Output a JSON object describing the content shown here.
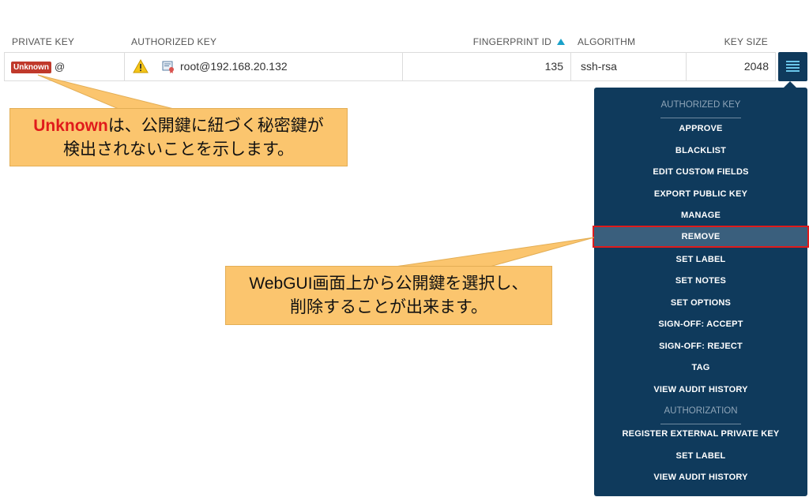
{
  "table": {
    "headers": {
      "private_key": "PRIVATE KEY",
      "authorized_key": "AUTHORIZED KEY",
      "fingerprint_id": "FINGERPRINT ID",
      "algorithm": "ALGORITHM",
      "key_size": "KEY SIZE"
    },
    "sort_icon": "sort-ascending-icon",
    "row": {
      "private_key_badge": "Unknown",
      "private_key_suffix": "@",
      "warning_icon": "warning-icon",
      "cert_icon": "certificate-icon",
      "authorized_key": "root@192.168.20.132",
      "fingerprint_id": "135",
      "algorithm": "ssh-rsa",
      "key_size": "2048"
    },
    "menu_icon": "hamburger-menu-icon"
  },
  "dropdown": {
    "section_authorized_key": "AUTHORIZED KEY",
    "authorized_key_items": [
      "APPROVE",
      "BLACKLIST",
      "EDIT CUSTOM FIELDS",
      "EXPORT PUBLIC KEY",
      "MANAGE",
      "REMOVE",
      "SET LABEL",
      "SET NOTES",
      "SET OPTIONS",
      "SIGN-OFF: ACCEPT",
      "SIGN-OFF: REJECT",
      "TAG",
      "VIEW AUDIT HISTORY"
    ],
    "section_authorization": "AUTHORIZATION",
    "authorization_items": [
      "REGISTER EXTERNAL PRIVATE KEY",
      "SET LABEL",
      "VIEW AUDIT HISTORY"
    ],
    "selected_item": "REMOVE"
  },
  "callouts": {
    "first": {
      "highlight": "Unknown",
      "line1_rest": "は、公開鍵に紐づく秘密鍵が",
      "line2": "検出されないことを示します。"
    },
    "second": {
      "line1": "WebGUI画面上から公開鍵を選択し、",
      "line2": "削除することが出来ます。"
    }
  },
  "colors": {
    "menu_bg": "#0f3a5c",
    "selected_bg": "#3a5f7d",
    "highlight_border": "#e01b1b",
    "badge": "#c0392b",
    "callout": "#fbc56e",
    "sort_arrow": "#1aa1c9"
  }
}
